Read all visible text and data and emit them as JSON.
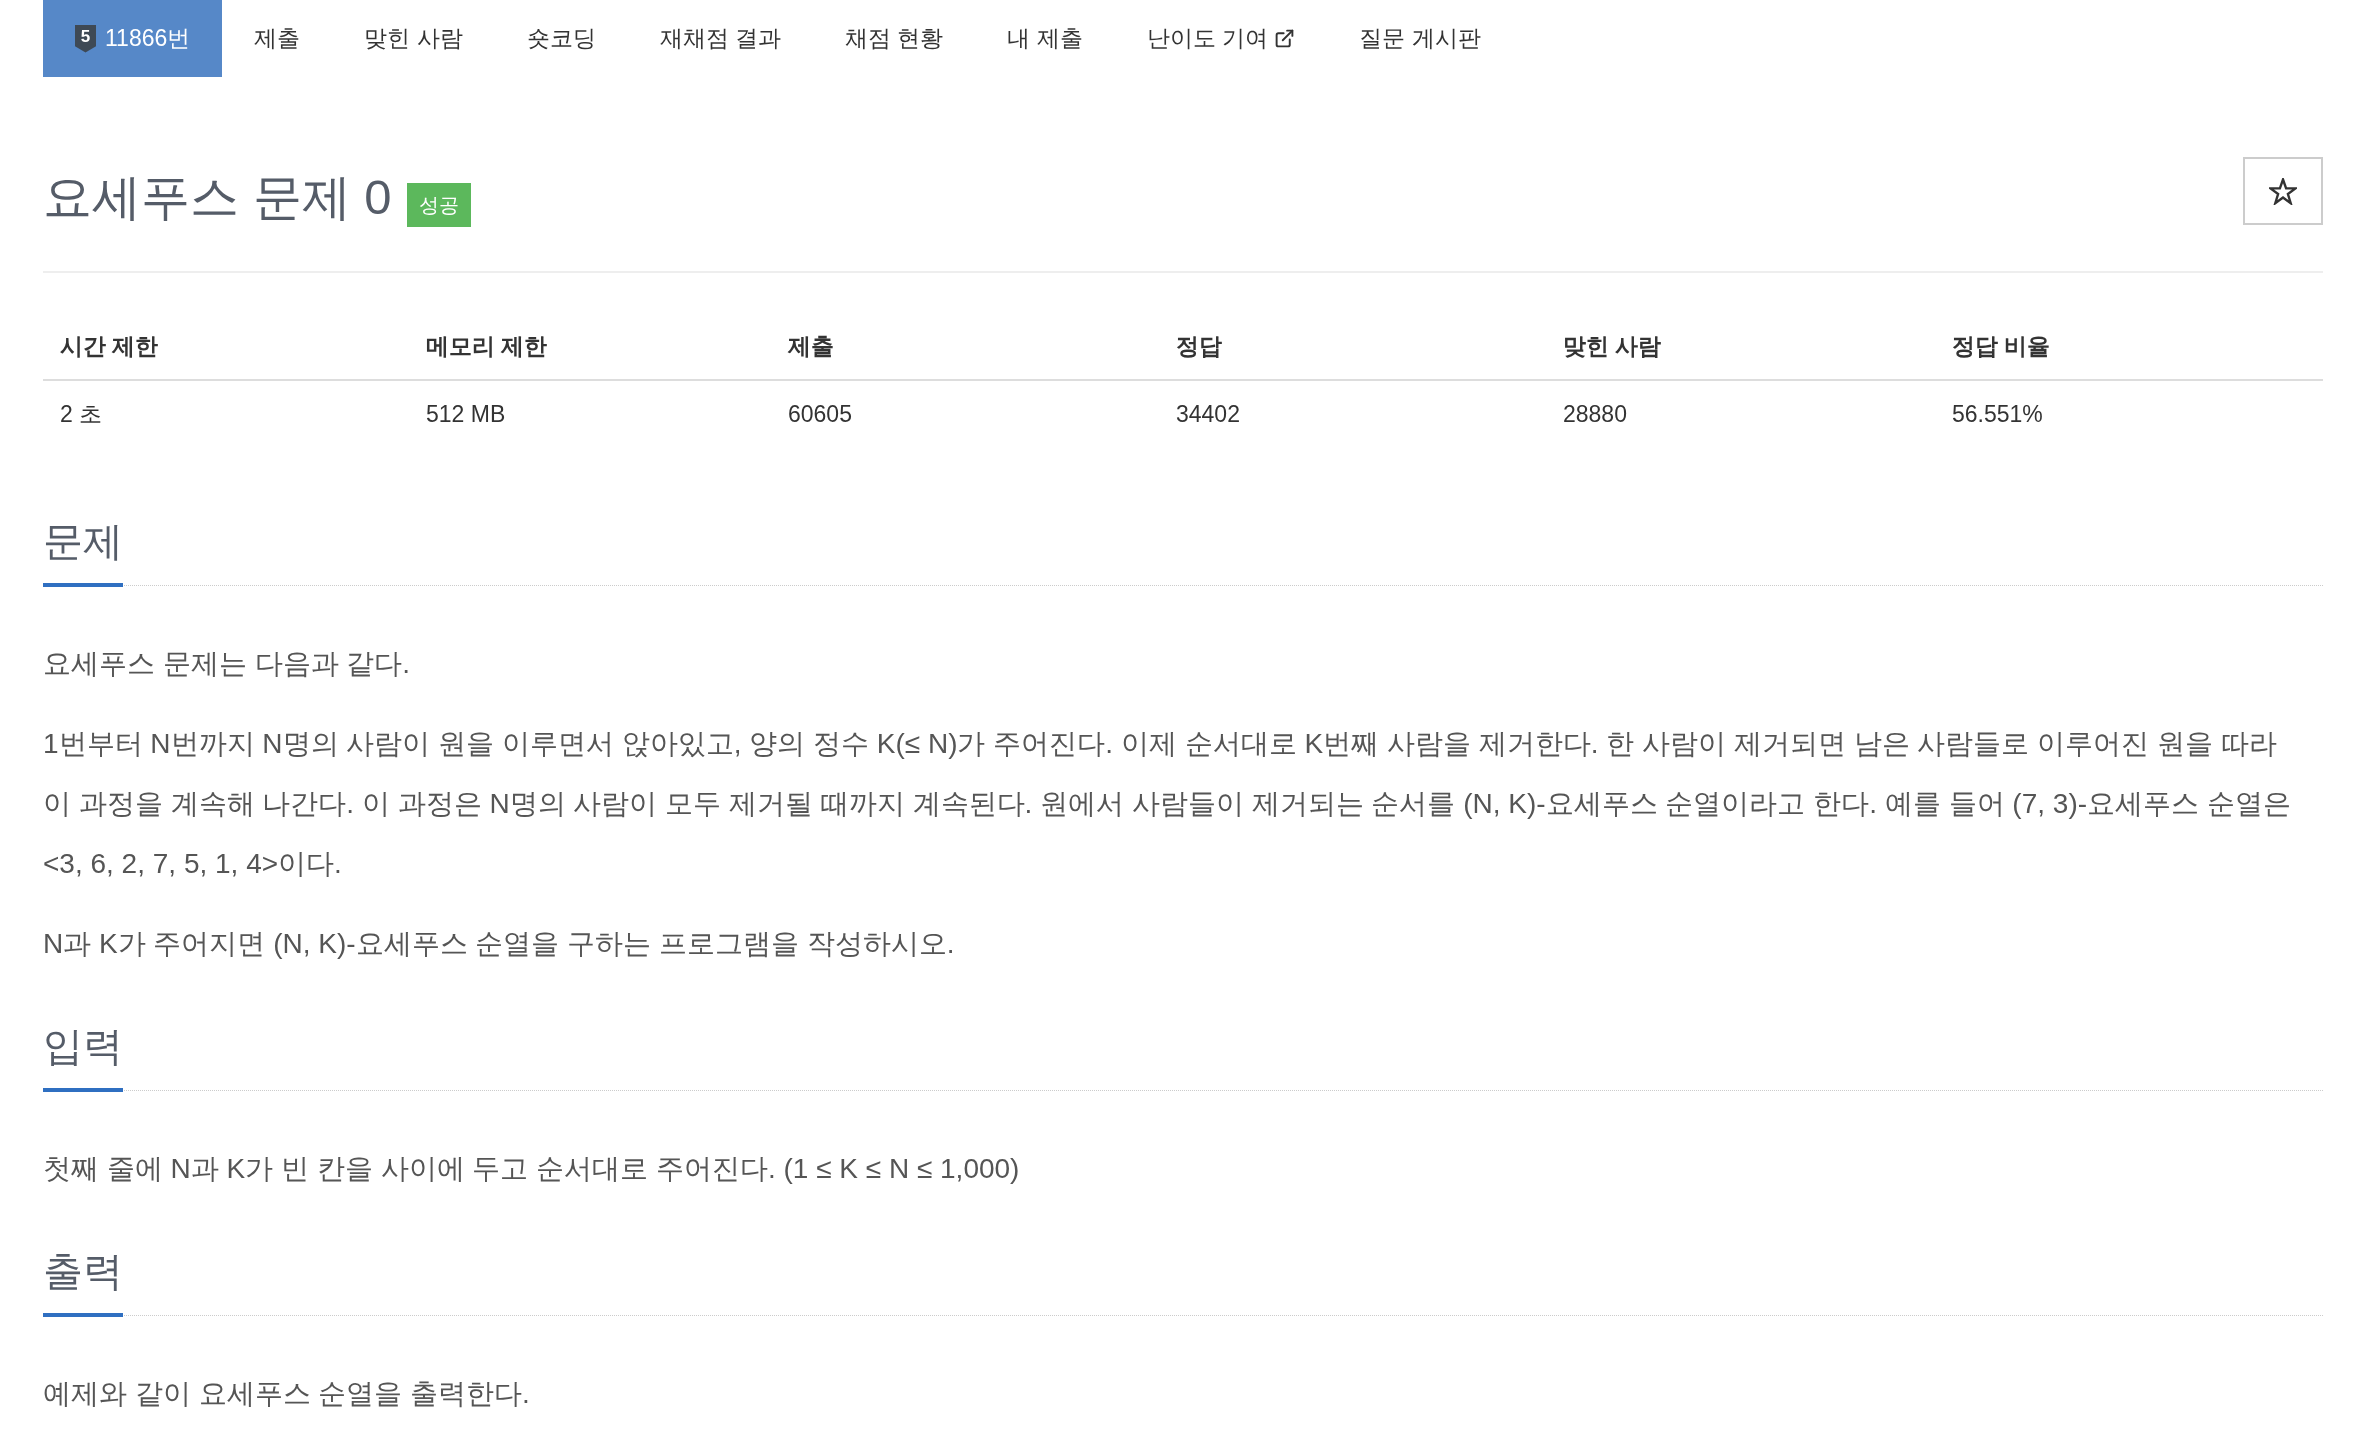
{
  "tabs": [
    {
      "label": "11866번",
      "badge": "5",
      "selected": true,
      "external": false
    },
    {
      "label": "제출",
      "selected": false,
      "external": false
    },
    {
      "label": "맞힌 사람",
      "selected": false,
      "external": false
    },
    {
      "label": "숏코딩",
      "selected": false,
      "external": false
    },
    {
      "label": "재채점 결과",
      "selected": false,
      "external": false
    },
    {
      "label": "채점 현황",
      "selected": false,
      "external": false
    },
    {
      "label": "내 제출",
      "selected": false,
      "external": false
    },
    {
      "label": "난이도 기여",
      "selected": false,
      "external": true
    },
    {
      "label": "질문 게시판",
      "selected": false,
      "external": false
    }
  ],
  "problem": {
    "title": "요세푸스 문제 0",
    "result": {
      "label": "성공",
      "kind": "success"
    },
    "favorite": false
  },
  "info_table": {
    "columns": [
      "시간 제한",
      "메모리 제한",
      "제출",
      "정답",
      "맞힌 사람",
      "정답 비율"
    ],
    "rows": [
      [
        "2 초",
        "512 MB",
        "60605",
        "34402",
        "28880",
        "56.551%"
      ]
    ]
  },
  "sections": [
    {
      "title": "문제",
      "paragraphs": [
        "요세푸스 문제는 다음과 같다.",
        "1번부터 N번까지 N명의 사람이 원을 이루면서 앉아있고, 양의 정수 K(≤ N)가 주어진다. 이제 순서대로 K번째 사람을 제거한다. 한 사람이 제거되면 남은 사람들로 이루어진 원을 따라 이 과정을 계속해 나간다. 이 과정은 N명의 사람이 모두 제거될 때까지 계속된다. 원에서 사람들이 제거되는 순서를 (N, K)-요세푸스 순열이라고 한다. 예를 들어 (7, 3)-요세푸스 순열은 <3, 6, 2, 7, 5, 1, 4>이다.",
        "N과 K가 주어지면 (N, K)-요세푸스 순열을 구하는 프로그램을 작성하시오."
      ]
    },
    {
      "title": "입력",
      "paragraphs": [
        "첫째 줄에 N과 K가 빈 칸을 사이에 두고 순서대로 주어진다. (1 ≤ K ≤ N ≤ 1,000)"
      ]
    },
    {
      "title": "출력",
      "paragraphs": [
        "예제와 같이 요세푸스 순열을 출력한다."
      ]
    }
  ]
}
